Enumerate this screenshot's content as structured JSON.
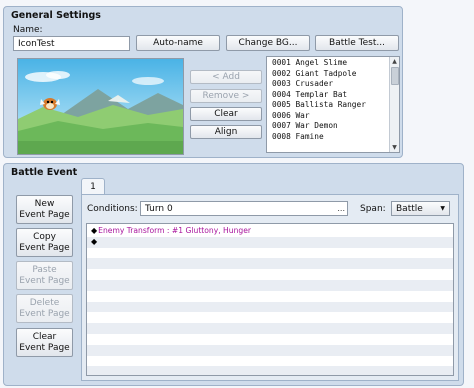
{
  "general": {
    "title": "General Settings",
    "name_label": "Name:",
    "name_value": "IconTest",
    "buttons": {
      "auto_name": "Auto-name",
      "change_bg": "Change BG...",
      "battle_test": "Battle Test...",
      "add": "< Add",
      "remove": "Remove >",
      "clear": "Clear",
      "align": "Align"
    },
    "enemies": [
      "0001 Angel Slime",
      "0002 Giant Tadpole",
      "0003 Crusader",
      "0004 Templar Bat",
      "0005 Ballista Ranger",
      "0006 War",
      "0007 War Demon",
      "0008 Famine"
    ]
  },
  "battle_event": {
    "title": "Battle Event",
    "buttons": {
      "new": [
        "New",
        "Event Page"
      ],
      "copy": [
        "Copy",
        "Event Page"
      ],
      "paste": [
        "Paste",
        "Event Page"
      ],
      "delete": [
        "Delete",
        "Event Page"
      ],
      "clear": [
        "Clear",
        "Event Page"
      ]
    },
    "tab": "1",
    "conditions_label": "Conditions:",
    "conditions_value": "Turn 0",
    "ellipsis": "...",
    "span_label": "Span:",
    "span_value": "Battle",
    "commands": [
      {
        "text": "Enemy Transform : #1 Gluttony, Hunger"
      },
      {
        "text": ""
      }
    ]
  },
  "colors": {
    "panel": "#cfdceb",
    "command_text": "#a8149c",
    "sky": "#6cc3ea",
    "grass": "#7ec36a"
  }
}
